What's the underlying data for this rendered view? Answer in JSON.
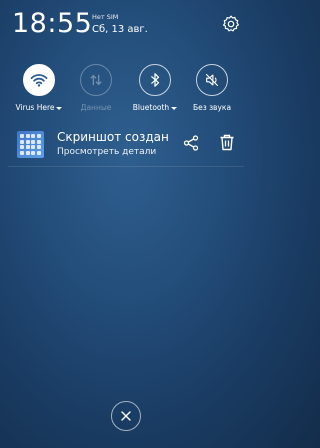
{
  "status": {
    "time": "18:55",
    "sim": "Нет SIM",
    "date": "Сб, 13 авг."
  },
  "toggles": [
    {
      "label": "Virus Here",
      "icon": "wifi-icon",
      "state": "on",
      "has_caret": true
    },
    {
      "label": "Данные",
      "icon": "mobile-data-icon",
      "state": "disabled",
      "has_caret": false
    },
    {
      "label": "Bluetooth",
      "icon": "bluetooth-icon",
      "state": "off",
      "has_caret": true
    },
    {
      "label": "Без звука",
      "icon": "mute-icon",
      "state": "off",
      "has_caret": false
    }
  ],
  "notification": {
    "title": "Скриншот создан",
    "subtitle": "Просмотреть детали",
    "icon": "screenshot-thumbnail",
    "actions": [
      "share-icon",
      "trash-icon"
    ]
  },
  "colors": {
    "background": "#1f4670",
    "toggle_on_fill": "#ffffff",
    "wifi_glyph": "#2a5d93"
  }
}
